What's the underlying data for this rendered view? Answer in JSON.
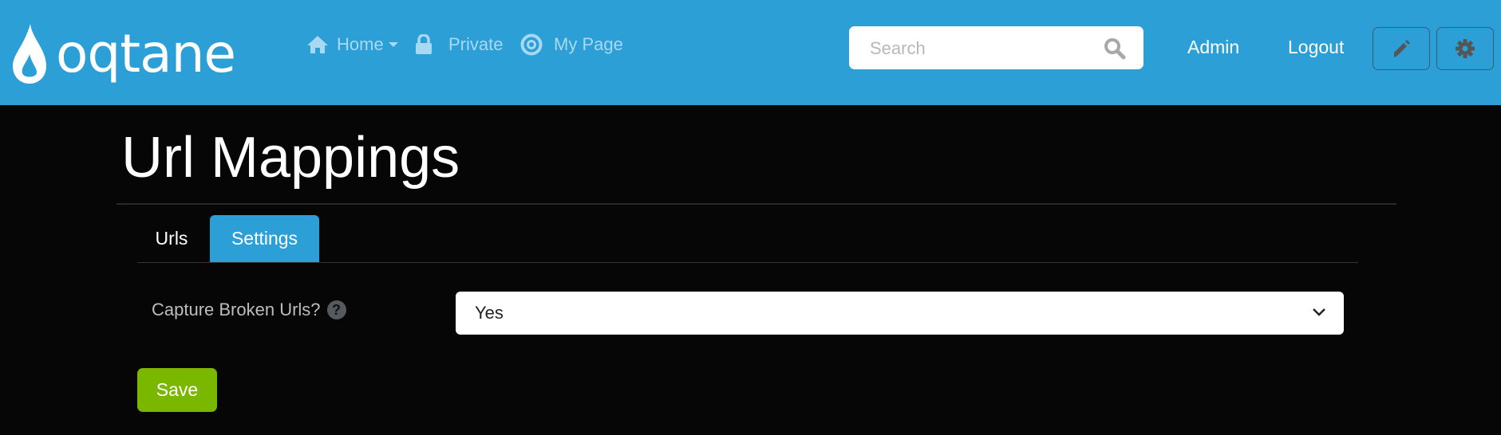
{
  "header": {
    "brand": "oqtane",
    "nav": [
      {
        "label": "Home",
        "icon": "home-icon",
        "dropdown": true
      },
      {
        "label": "Private",
        "icon": "lock-icon"
      },
      {
        "label": "My Page",
        "icon": "target-icon"
      }
    ],
    "search_placeholder": "Search",
    "search_value": "",
    "admin_label": "Admin",
    "logout_label": "Logout",
    "edit_icon": "pencil-icon",
    "settings_icon": "gear-icon"
  },
  "colors": {
    "header": "#2b9fd6",
    "active_tab": "#2b9fd6",
    "save": "#7ab800",
    "background": "#060606"
  },
  "main": {
    "title": "Url Mappings",
    "tabs": [
      {
        "label": "Urls",
        "active": false
      },
      {
        "label": "Settings",
        "active": true
      }
    ],
    "settings": {
      "capture_label": "Capture Broken Urls?",
      "help_glyph": "?",
      "capture_value": "Yes"
    },
    "save_label": "Save"
  }
}
